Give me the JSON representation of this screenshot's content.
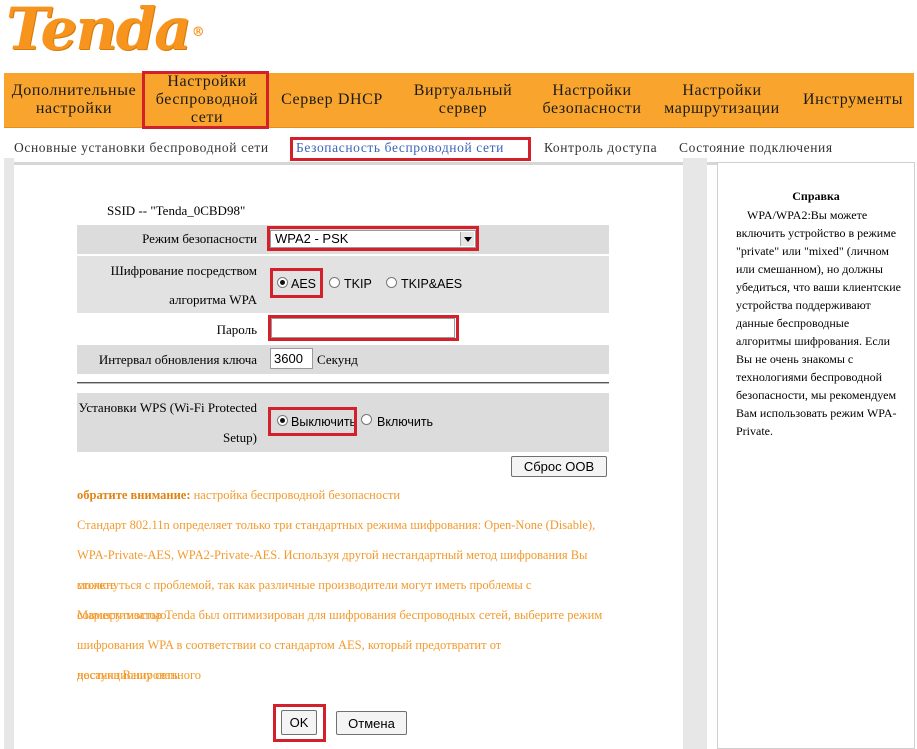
{
  "brand": {
    "logo_text": "Tenda",
    "registered_mark": "®"
  },
  "nav": {
    "items": [
      {
        "label": "Дополнительные\nнастройки"
      },
      {
        "label": "Настройки\nбеспроводной\nсети"
      },
      {
        "label": "Сервер DHCP"
      },
      {
        "label": "Виртуальный\nсервер"
      },
      {
        "label": "Настройки\nбезопасности"
      },
      {
        "label": "Настройки\nмаршрутизации"
      },
      {
        "label": "Инструменты"
      }
    ],
    "active_index": 1
  },
  "subnav": {
    "items": [
      {
        "label": "Основные установки беспроводной сети"
      },
      {
        "label": "Безопасность беспроводной сети"
      },
      {
        "label": "Контроль доступа"
      },
      {
        "label": "Состояние подключения"
      }
    ],
    "active_index": 1
  },
  "form": {
    "ssid_text": "SSID -- \"Tenda_0CBD98\"",
    "security_mode": {
      "label": "Режим безопасности",
      "value": "WPA2 - PSK"
    },
    "encryption": {
      "label_line1": "Шифрование посредством",
      "label_line2": "алгоритма WPA",
      "options": [
        "AES",
        "TKIP",
        "TKIP&AES"
      ],
      "selected": "AES"
    },
    "password": {
      "label": "Пароль",
      "value": ""
    },
    "key_interval": {
      "label": "Интервал обновления ключа",
      "value": "3600",
      "unit": "Секунд"
    },
    "wps": {
      "label_line1": "Установки WPS (Wi-Fi Protected",
      "label_line2": "Setup)",
      "options": [
        "Выключить",
        "Включить"
      ],
      "selected": "Выключить"
    },
    "reset_oob_label": "Сброс OOB"
  },
  "note": {
    "heading": "обратите внимание:",
    "heading_rest": " настройка беспроводной безопасности",
    "lines": [
      "Стандарт 802.11n определяет только три стандартных режима шифрования: Open-None (Disable),",
      "WPA-Private-AES, WPA2-Private-AES. Используя другой нестандартный метод шифрования Вы можете",
      "столкнуться с проблемой, так как различные производители могут иметь проблемы с совместимостью.",
      "Маршрутизатор Tenda был оптимизирован для шифрования беспроводных сетей, выберите режим",
      "шифрования WPA в соответствии со стандартом AES, который предотвратит от несанкционированного",
      "доступа Вашу сеть."
    ]
  },
  "actions": {
    "ok_label": "OK",
    "cancel_label": "Отмена"
  },
  "help": {
    "title": "Справка",
    "text": "WPA/WPA2:Вы можете включить устройство в режиме \"private\" или \"mixed\" (личном или смешанном), но должны убедиться, что ваши клиентские устройства поддерживают данные беспроводные алгоритмы шифрования. Если Вы не очень знакомы с технологиями беспроводной безопасности, мы рекомендуем Вам использовать режим WPA-Private."
  },
  "colors": {
    "nav_bg": "#f9a52d",
    "logo": "#f7941d",
    "highlight": "#d4202a",
    "note_text": "#f39a2c",
    "active_subnav": "#3a63b7"
  }
}
